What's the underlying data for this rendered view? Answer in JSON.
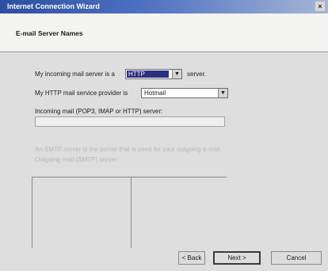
{
  "window": {
    "title": "Internet Connection Wizard",
    "close_glyph": "×"
  },
  "page": {
    "heading": "E-mail Server Names"
  },
  "form": {
    "incoming_prefix": "My incoming mail server is a",
    "incoming_type": "HTTP",
    "incoming_suffix": "server.",
    "provider_label": "My HTTP mail service provider is",
    "provider_value": "Hotmail",
    "incoming_server_label": "Incoming mail (POP3, IMAP or HTTP) server:",
    "outgoing_label": "An SMTP server is the server that is used for your outgoing e-mail.",
    "outgoing_server_label": "Outgoing mail (SMTP) server:"
  },
  "buttons": {
    "back": "< Back",
    "next": "Next >",
    "cancel": "Cancel"
  },
  "icons": {
    "close": "close-icon",
    "dropdown": "chevron-down-icon"
  }
}
